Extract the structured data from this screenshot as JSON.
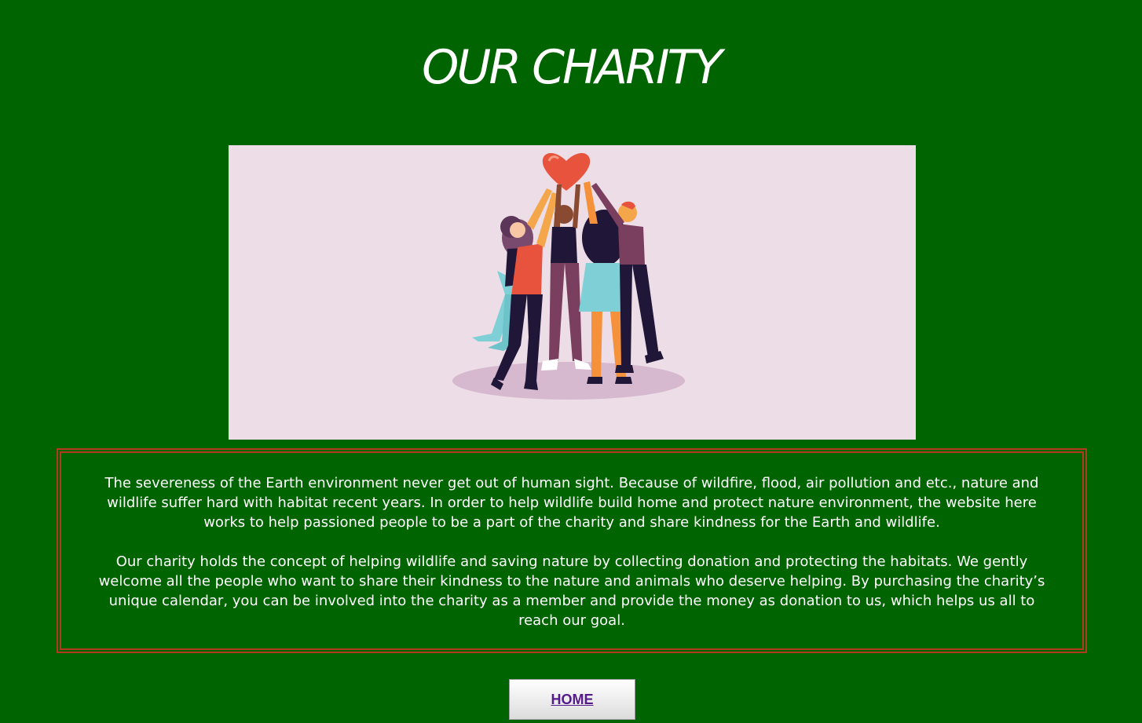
{
  "page": {
    "title": "OUR CHARITY",
    "background_color": "#006400",
    "text_color": "#ffffff",
    "accent_border_color": "#b23a1f"
  },
  "hero_image": {
    "description_icon": "people-holding-heart-illustration",
    "background_color": "#ecdde6"
  },
  "info": {
    "paragraph_1": "The severeness of the Earth environment never get out of human sight. Because of wildfire, flood, air pollution and etc., nature and wildlife suffer hard with habitat recent years. In order to help wildlife build home and protect nature environment, the website here works to help passioned people to be a part of the charity and share kindness for the Earth and wildlife.",
    "paragraph_2": "Our charity holds the concept of helping wildlife and saving nature by collecting donation and protecting the habitats. We gently welcome all the people who want to share their kindness to the nature and animals who deserve helping. By purchasing the charity’s unique calendar, you can be involved into the charity as a member and provide the money as donation to us, which helps us all to reach our goal."
  },
  "nav": {
    "home_label": "HOME",
    "link_color": "#551a8b"
  }
}
